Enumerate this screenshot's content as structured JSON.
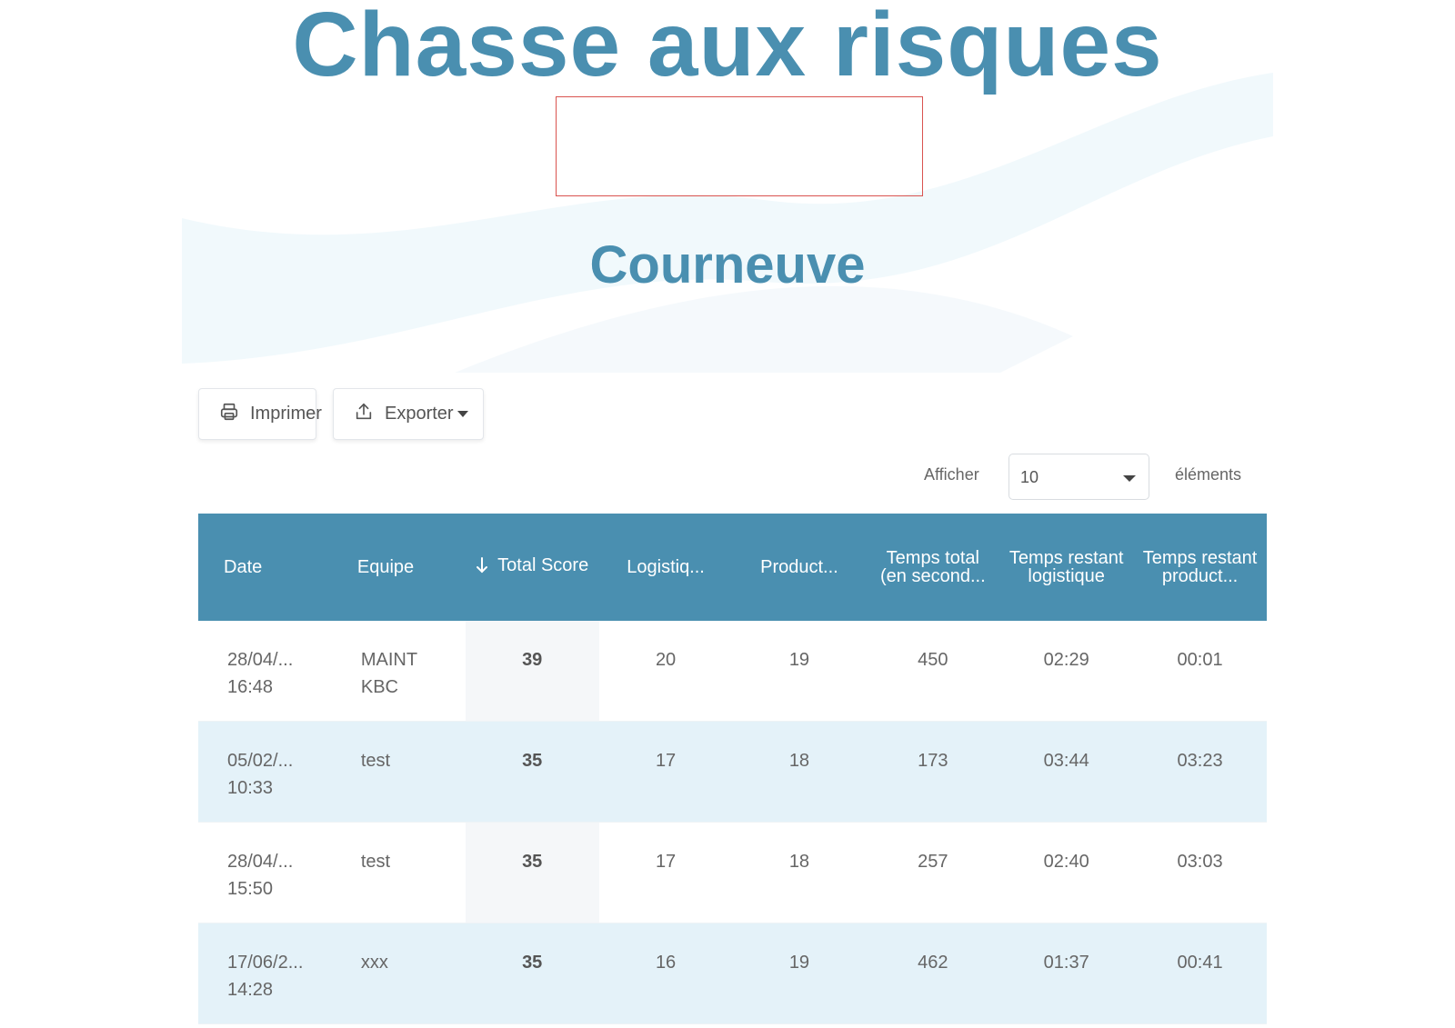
{
  "header": {
    "title": "Chasse aux risques",
    "subtitle": "Courneuve"
  },
  "toolbar": {
    "print_label": "Imprimer",
    "export_label": "Exporter"
  },
  "length": {
    "show_label": "Afficher",
    "selected": "10",
    "elements_label": "éléments"
  },
  "table": {
    "columns": [
      "Date",
      "Equipe",
      "Total Score",
      "Logistiq...",
      "Product...",
      "Temps total (en second...",
      "Temps restant logistique",
      "Temps restant product..."
    ],
    "rows": [
      {
        "date": "28/04/...",
        "time": "16:48",
        "team1": "MAINT",
        "team2": "KBC",
        "score": "39",
        "logistique": "20",
        "production": "19",
        "temps_total": "450",
        "restant_log": "02:29",
        "restant_prod": "00:01"
      },
      {
        "date": "05/02/...",
        "time": "10:33",
        "team1": "test",
        "team2": "",
        "score": "35",
        "logistique": "17",
        "production": "18",
        "temps_total": "173",
        "restant_log": "03:44",
        "restant_prod": "03:23"
      },
      {
        "date": "28/04/...",
        "time": "15:50",
        "team1": "test",
        "team2": "",
        "score": "35",
        "logistique": "17",
        "production": "18",
        "temps_total": "257",
        "restant_log": "02:40",
        "restant_prod": "03:03"
      },
      {
        "date": "17/06/2...",
        "time": "14:28",
        "team1": "xxx",
        "team2": "",
        "score": "35",
        "logistique": "16",
        "production": "19",
        "temps_total": "462",
        "restant_log": "01:37",
        "restant_prod": "00:41"
      }
    ]
  },
  "colors": {
    "brand": "#4a8fb0",
    "row_alt": "#e4f2f9",
    "logo_border": "#d9534f"
  },
  "icons": {
    "print": "printer-icon",
    "export": "upload-icon",
    "sort": "arrow-down-icon"
  }
}
